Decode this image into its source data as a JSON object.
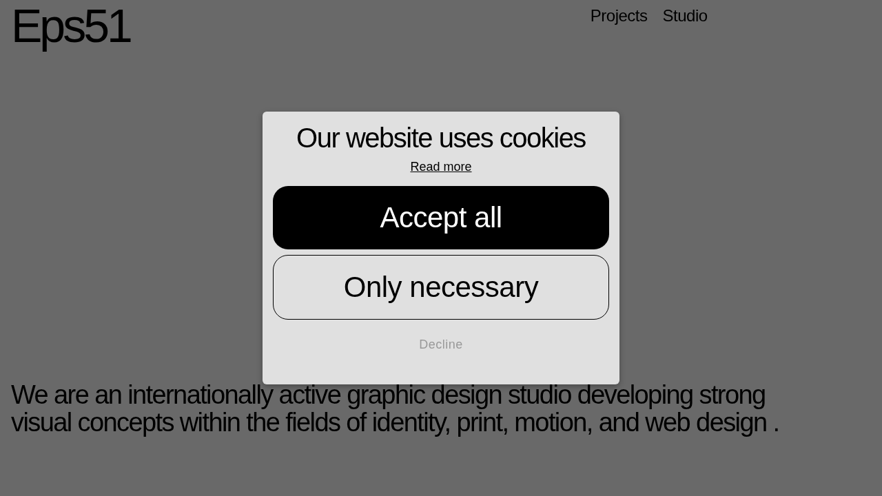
{
  "logo": "Eps51",
  "nav": [
    {
      "label": "Projects"
    },
    {
      "label": "Studio"
    }
  ],
  "cookie_dialog": {
    "title": "Our website uses cookies",
    "read_more": "Read more",
    "buttons": [
      {
        "label": "Accept all",
        "kind": "primary"
      },
      {
        "label": "Only necessary",
        "kind": "outline"
      },
      {
        "label": "Decline",
        "kind": "text"
      }
    ]
  },
  "intro": "We are an internationally active graphic design studio developing strong visual concepts within the fields of identity, print, motion, and web design ."
}
